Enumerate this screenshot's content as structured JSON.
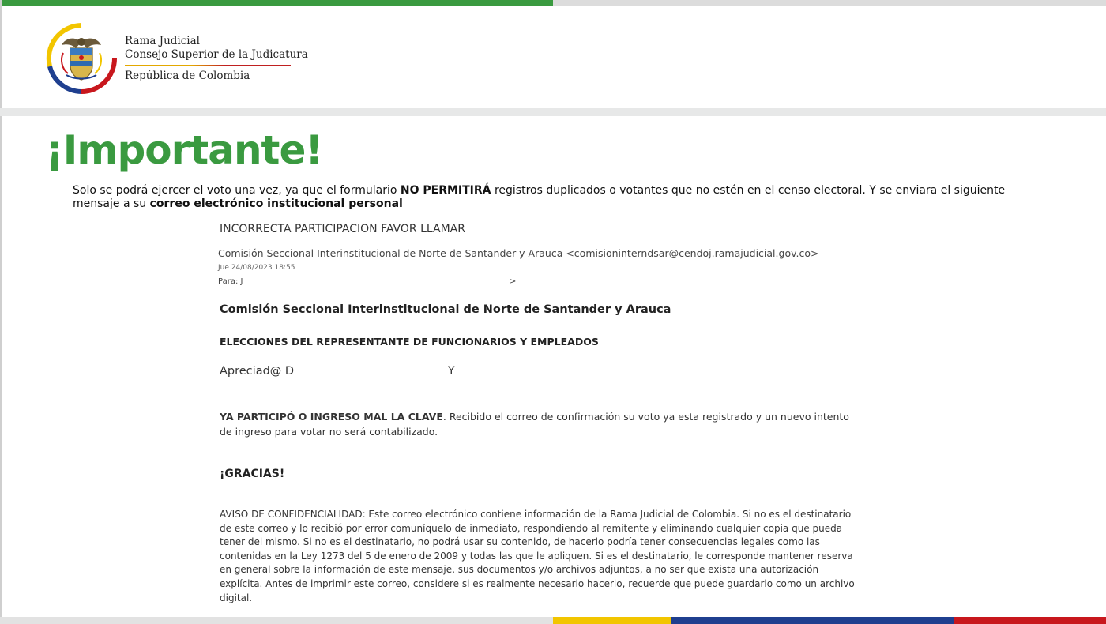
{
  "header": {
    "brand_line1": "Rama Judicial",
    "brand_line2": "Consejo Superior de la Judicatura",
    "brand_sub": "República de Colombia"
  },
  "colors": {
    "accent_green": "#3a9a40",
    "flag_yellow": "#f2c500",
    "flag_blue": "#1f3f8f",
    "flag_red": "#c8171d"
  },
  "title": "¡Importante!",
  "intro": {
    "part1": "Solo se podrá ejercer el voto una vez, ya que el formulario ",
    "bold1": "NO PERMITIRÁ",
    "part2": "  registros duplicados o votantes que no estén en el censo electoral. Y se enviara el siguiente mensaje a su ",
    "bold2": "correo electrónico institucional personal"
  },
  "email": {
    "subject": "INCORRECTA PARTICIPACION FAVOR LLAMAR",
    "from": "Comisión Seccional Interinstitucional de Norte de Santander y Arauca <comisioninterndsar@cendoj.ramajudicial.gov.co>",
    "date": "Jue 24/08/2023 18:55",
    "to_label": "Para: J",
    "to_end": ">",
    "org_heading": "Comisión Seccional Interinstitucional de Norte de Santander y Arauca",
    "elections_heading": "ELECCIONES DEL REPRESENTANTE DE FUNCIONARIOS Y EMPLEADOS",
    "greeting": "Apreciad@ D",
    "greeting_end": "Y",
    "body_bold": "YA PARTICIPÓ O INGRESO MAL LA CLAVE",
    "body_rest": ". Recibido el correo de confirmación su voto ya esta registrado y un nuevo intento de ingreso para votar no será contabilizado.",
    "thanks": "¡GRACIAS!",
    "notice": "AVISO DE CONFIDENCIALIDAD: Este correo electrónico contiene información de la Rama Judicial de Colombia. Si no es el destinatario de este correo y lo recibió por error comuníquelo de inmediato, respondiendo al remitente y eliminando cualquier copia que pueda tener del mismo. Si no es el destinatario, no podrá usar su contenido, de hacerlo podría tener consecuencias legales como las contenidas en la Ley 1273 del 5 de enero de 2009 y todas las que le apliquen. Si es el destinatario, le corresponde mantener reserva en general sobre la información de este mensaje, sus documentos y/o archivos adjuntos, a no ser que exista una autorización explícita. Antes de imprimir este correo, considere si es realmente necesario hacerlo, recuerde que puede guardarlo como un archivo digital."
  }
}
